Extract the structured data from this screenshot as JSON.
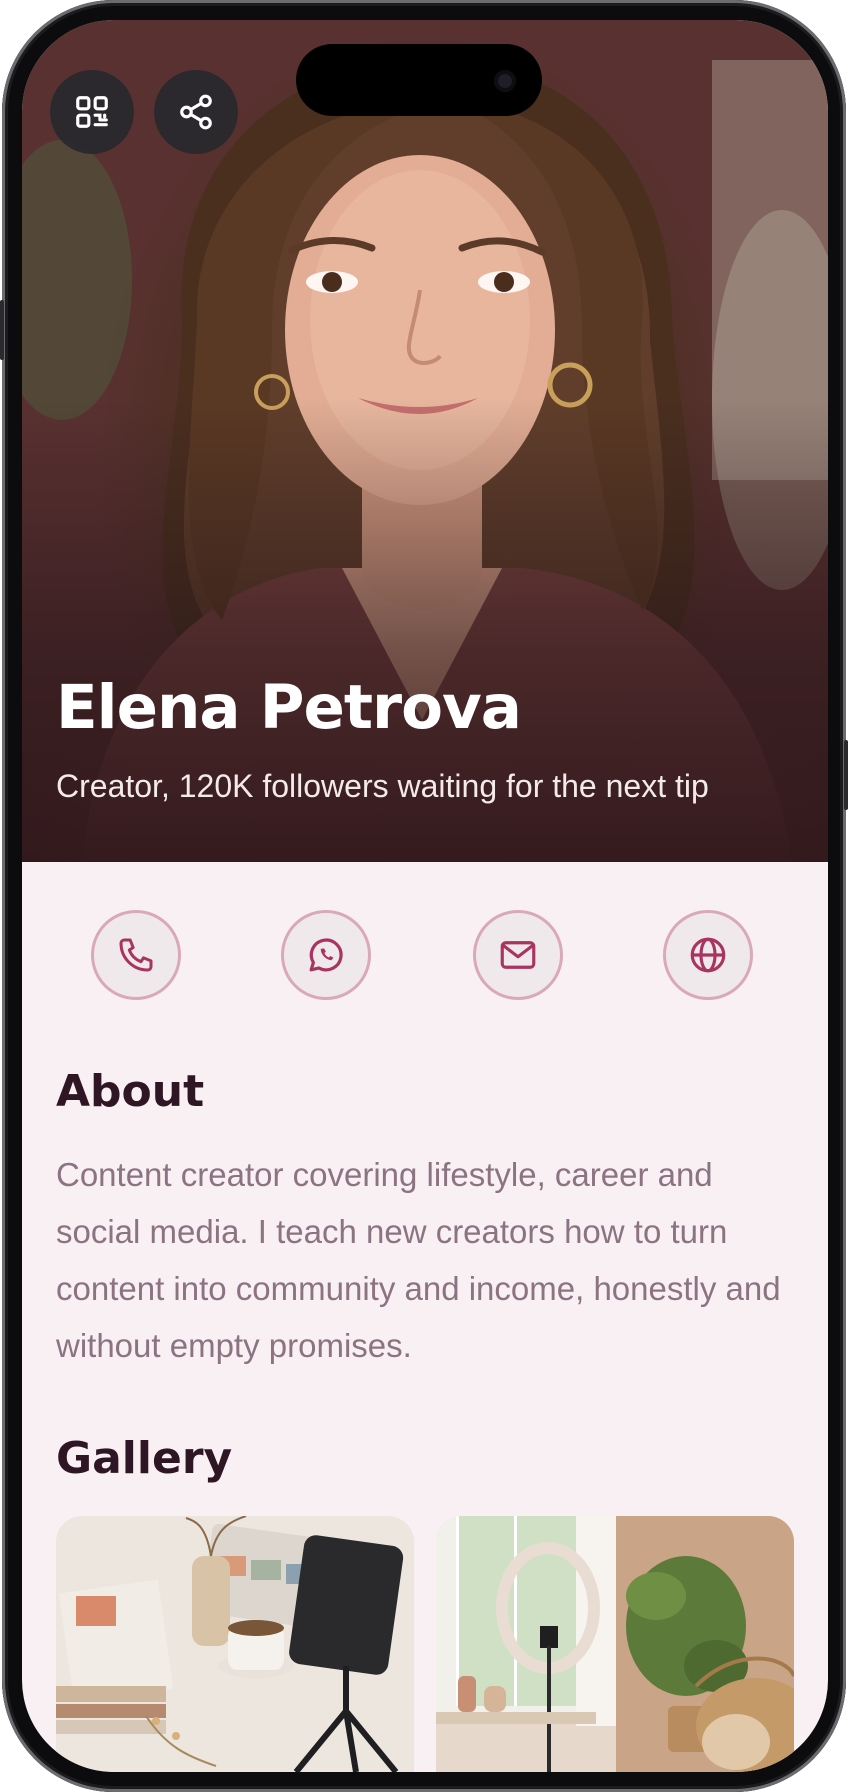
{
  "profile": {
    "name": "Elena Petrova",
    "tagline": "Creator, 120K followers waiting for the next tip"
  },
  "hero_actions": [
    {
      "icon": "qr-code-icon"
    },
    {
      "icon": "share-icon"
    }
  ],
  "contact_actions": [
    {
      "icon": "phone-icon"
    },
    {
      "icon": "whatsapp-icon"
    },
    {
      "icon": "mail-icon"
    },
    {
      "icon": "globe-icon"
    }
  ],
  "about": {
    "title": "About",
    "text": "Content creator covering lifestyle, career and social media. I teach new creators how to turn content into community and income, honestly and without empty promises."
  },
  "gallery": {
    "title": "Gallery"
  },
  "colors": {
    "accent": "#a8345f",
    "background": "#f9f0f3",
    "title": "#2e1624",
    "body_text": "#8c7382"
  }
}
